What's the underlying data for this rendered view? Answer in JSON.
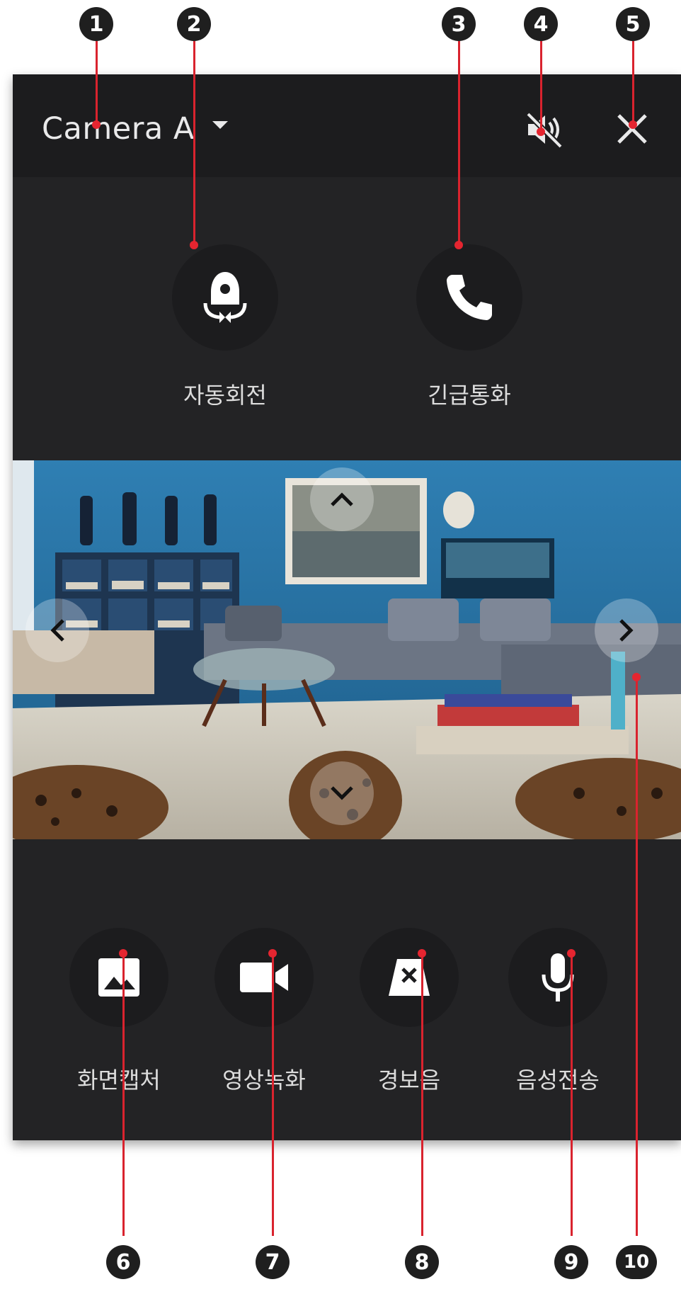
{
  "header": {
    "camera_name": "Camera A",
    "mute_icon": "speaker-muted-icon",
    "close_icon": "close-icon"
  },
  "top_actions": [
    {
      "label": "자동회전",
      "icon": "auto-rotate-icon"
    },
    {
      "label": "긴급통화",
      "icon": "phone-icon"
    }
  ],
  "feed": {
    "up_icon": "chevron-up-icon",
    "down_icon": "chevron-down-icon",
    "left_icon": "chevron-left-icon",
    "right_icon": "chevron-right-icon"
  },
  "bottom_actions": [
    {
      "label": "화면캡처",
      "icon": "image-icon"
    },
    {
      "label": "영상녹화",
      "icon": "video-camera-icon"
    },
    {
      "label": "경보음",
      "icon": "alarm-icon"
    },
    {
      "label": "음성전송",
      "icon": "microphone-icon"
    }
  ],
  "callouts": [
    "1",
    "2",
    "3",
    "4",
    "5",
    "6",
    "7",
    "8",
    "9",
    "10"
  ],
  "colors": {
    "accent": "#e52530",
    "panel": "#232325",
    "topbar": "#1c1c1e"
  }
}
